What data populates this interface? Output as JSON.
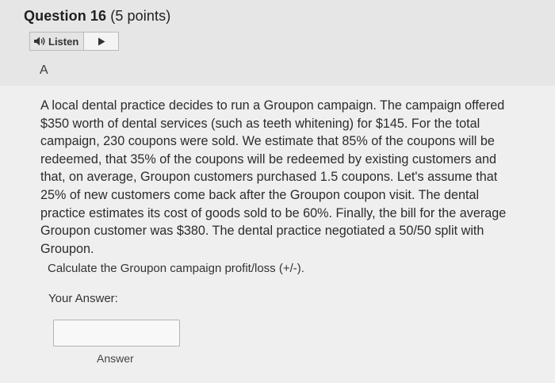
{
  "question": {
    "number_label": "Question 16",
    "points_label": "(5 points)"
  },
  "listen": {
    "label": "Listen",
    "speaker_icon": "speaker-icon",
    "play_icon": "play-icon"
  },
  "section_letter": "A",
  "body_text": "A local dental practice decides to run a Groupon campaign. The campaign offered $350 worth of dental services (such as teeth whitening) for $145. For the total campaign, 230 coupons were sold. We estimate that 85% of the coupons will be redeemed, that 35% of the coupons will be redeemed by existing customers and that, on average, Groupon customers purchased 1.5 coupons. Let's assume that 25% of new customers come back after the Groupon coupon visit. The dental practice estimates its cost of goods sold to be 60%. Finally, the bill for the average Groupon customer was $380. The dental practice negotiated a 50/50 split with Groupon.",
  "prompt": "Calculate the Groupon campaign profit/loss (+/-).",
  "answer": {
    "label": "Your Answer:",
    "value": "",
    "caption": "Answer"
  }
}
